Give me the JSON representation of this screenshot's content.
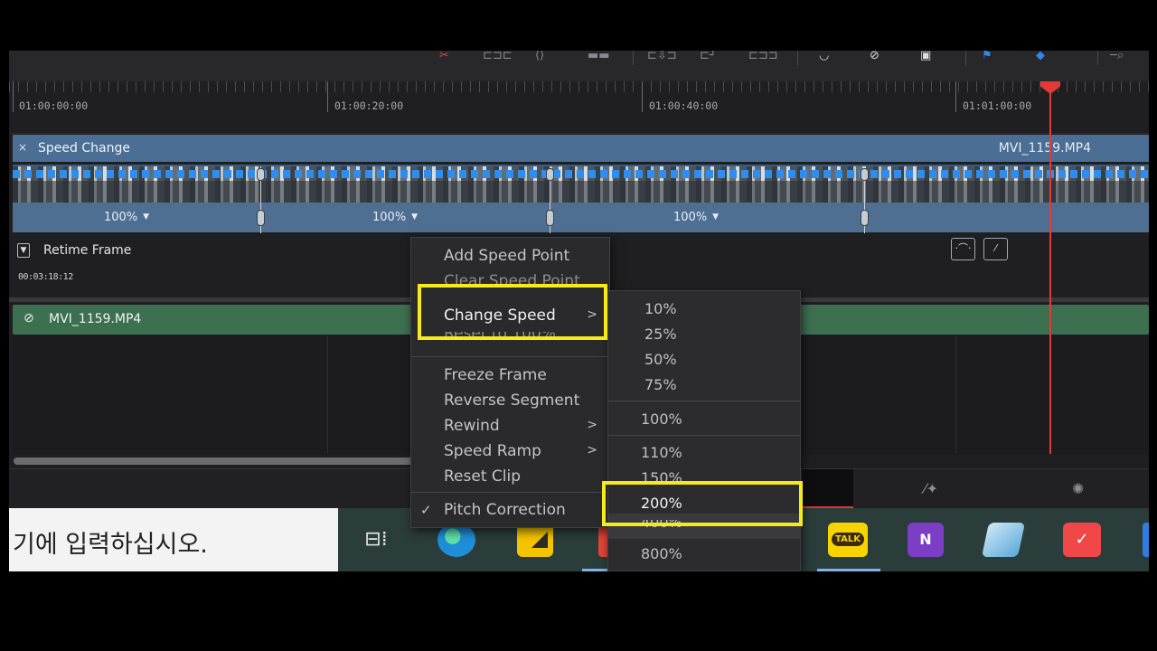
{
  "timeline": {
    "timecodes": [
      "01:00:00:00",
      "01:00:20:00",
      "01:00:40:00",
      "01:01:00:00"
    ]
  },
  "speed_track": {
    "title": "Speed Change",
    "close_icon": "×",
    "clip_name": "MVI_1159.MP4",
    "segments": [
      "100%",
      "100%",
      "100%"
    ],
    "dropdown_glyph": "▼"
  },
  "retime": {
    "label": "Retime Frame",
    "timecode": "00:03:18:12"
  },
  "video_track": {
    "link_icon": "🔗",
    "clip_name": "MVI_1159.MP4"
  },
  "context_menu": {
    "items": [
      {
        "label": "Add Speed Point"
      },
      {
        "label": "Clear Speed Point"
      },
      {
        "label": "Change Speed"
      },
      {
        "label": "Reset to 100%"
      },
      {
        "label": "Freeze Frame"
      },
      {
        "label": "Reverse Segment"
      },
      {
        "label": "Rewind"
      },
      {
        "label": "Speed Ramp"
      },
      {
        "label": "Reset Clip"
      },
      {
        "label": "Pitch Correction"
      }
    ],
    "submenu_arrow": ">",
    "checkmark": "✓"
  },
  "speed_submenu": {
    "options": [
      "10%",
      "25%",
      "50%",
      "75%",
      "100%",
      "110%",
      "150%",
      "200%",
      "400%",
      "800%"
    ],
    "selected": "200%"
  },
  "taskbar": {
    "search_placeholder": "기에 입력하십시오.",
    "kakao_label": "TALK",
    "onenote_label": "N"
  },
  "colors": {
    "highlight": "#f7ea1c",
    "playhead": "#e53935",
    "speed_track": "#4a6e94",
    "video_track": "#3d7050"
  }
}
